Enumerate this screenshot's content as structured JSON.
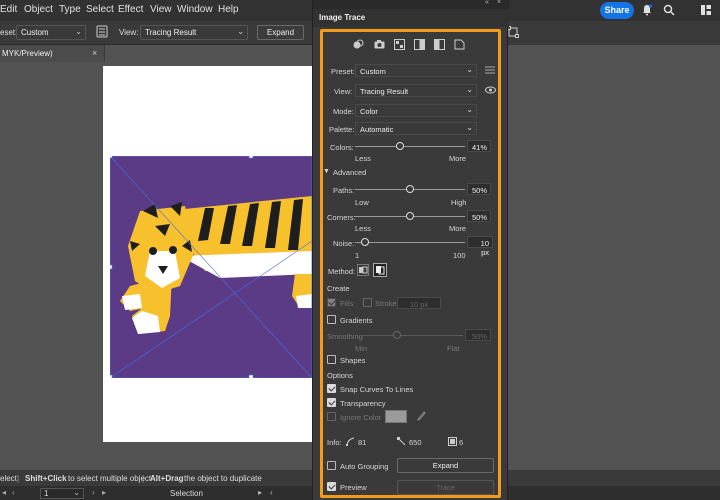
{
  "menubar": {
    "items": [
      "Edit",
      "Object",
      "Type",
      "Select",
      "Effect",
      "View",
      "Window",
      "Help"
    ],
    "share_label": "Share"
  },
  "controlbar": {
    "preset_label": "eset:",
    "preset_value": "Custom",
    "view_label": "View:",
    "view_value": "Tracing Result",
    "expand_label": "Expand"
  },
  "document": {
    "tab_title": "MYK/Preview)",
    "close_glyph": "×"
  },
  "statusbar": {
    "hint_a": "elect",
    "hint_b": "Shift+Click",
    "hint_c": "to select multiple object",
    "hint_d": "Alt+Drag",
    "hint_e": "the object to duplicate",
    "page_value": "1",
    "tool_name": "Selection"
  },
  "panel": {
    "title": "Image Trace",
    "preset": {
      "label": "Preset:",
      "value": "Custom"
    },
    "view": {
      "label": "View:",
      "value": "Tracing Result"
    },
    "mode": {
      "label": "Mode:",
      "value": "Color"
    },
    "palette": {
      "label": "Palette:",
      "value": "Automatic"
    },
    "colors": {
      "label": "Colors:",
      "value": "41%",
      "fraction": 0.41,
      "min_label": "Less",
      "max_label": "More"
    },
    "advanced_label": "Advanced",
    "paths": {
      "label": "Paths:",
      "value": "50%",
      "fraction": 0.5,
      "min_label": "Low",
      "max_label": "High"
    },
    "corners": {
      "label": "Corners:",
      "value": "50%",
      "fraction": 0.5,
      "min_label": "Less",
      "max_label": "More"
    },
    "noise": {
      "label": "Noise:",
      "value": "10 px",
      "fraction": 0.09,
      "min_label": "1",
      "max_label": "100"
    },
    "method_label": "Method:",
    "create_label": "Create",
    "create_fills": "Fills",
    "create_strokes": "Strokes",
    "stroke_value": "10 px",
    "gradients_label": "Gradients",
    "gradient_stroke_label": "Smoothing",
    "gradient_stroke_value": "50%",
    "gradient_min": "Min",
    "gradient_max": "Flat",
    "shapes_label": "Shapes",
    "options_label": "Options",
    "snap_label": "Snap Curves To Lines",
    "transparency_label": "Transparency",
    "ignore_color_label": "Ignore Color",
    "info_label": "Info:",
    "info_paths": "81",
    "info_anchors": "650",
    "info_colors": "6",
    "auto_grouping_label": "Auto Grouping",
    "expand_label": "Expand",
    "preview_label": "Preview",
    "trace_label": "Trace"
  },
  "colors": {
    "accent_highlight": "#f39c19",
    "share_blue": "#1473e6",
    "artwork_purple": "#5b3a86",
    "tiger_yellow": "#f7c12d"
  }
}
